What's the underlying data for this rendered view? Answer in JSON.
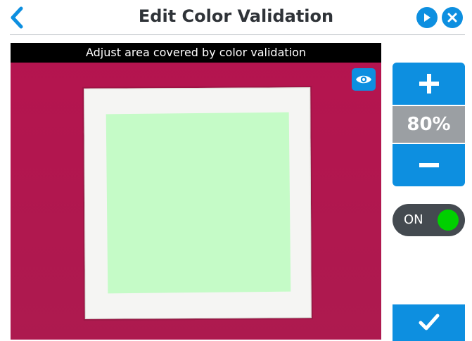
{
  "header": {
    "title": "Edit Color Validation",
    "back_icon": "chevron-left-icon",
    "play_icon": "play-icon",
    "close_icon": "close-icon"
  },
  "camera": {
    "caption": "Adjust area covered by color validation",
    "eye_icon": "eye-icon",
    "background_color": "#b0174f",
    "area_color": "#c5fbc7"
  },
  "controls": {
    "increase_icon": "plus-icon",
    "percent": "80%",
    "decrease_icon": "minus-icon",
    "toggle_label": "ON",
    "toggle_state": true,
    "confirm_icon": "checkmark-icon"
  },
  "colors": {
    "accent": "#0d8fe0",
    "toggle_on": "#00d000",
    "percent_bg": "#9b9fa3"
  }
}
